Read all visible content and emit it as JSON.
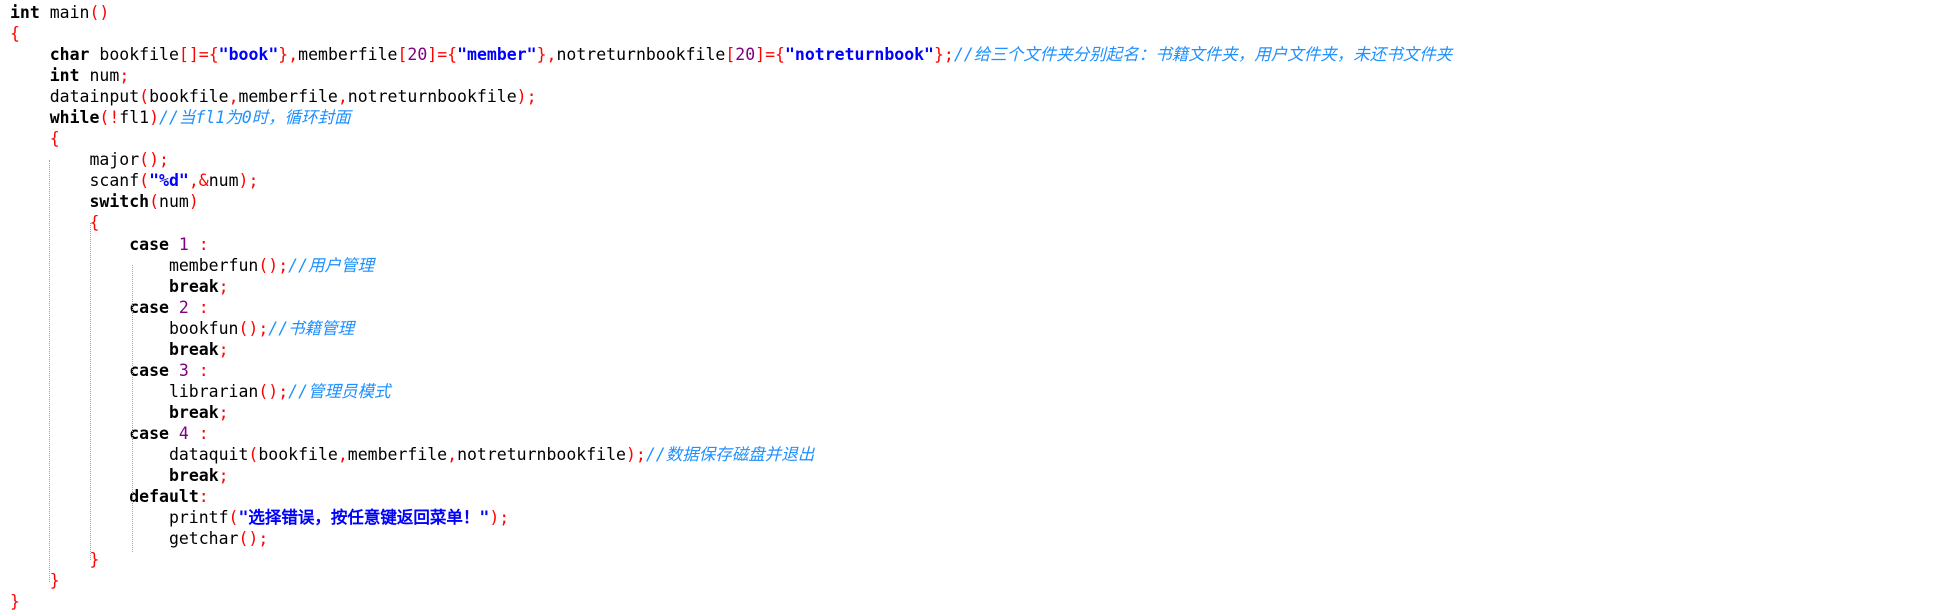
{
  "code": {
    "lines": [
      [
        {
          "t": "int",
          "c": "kw"
        },
        {
          "t": " main",
          "c": "plain"
        },
        {
          "t": "()",
          "c": "punc"
        }
      ],
      [
        {
          "t": "{",
          "c": "brace"
        }
      ],
      [
        {
          "t": "    ",
          "c": "plain"
        },
        {
          "t": "char",
          "c": "kw"
        },
        {
          "t": " bookfile",
          "c": "plain"
        },
        {
          "t": "[]={",
          "c": "punc"
        },
        {
          "t": "\"book\"",
          "c": "str"
        },
        {
          "t": "},",
          "c": "punc"
        },
        {
          "t": "memberfile",
          "c": "plain"
        },
        {
          "t": "[",
          "c": "punc"
        },
        {
          "t": "20",
          "c": "num"
        },
        {
          "t": "]={",
          "c": "punc"
        },
        {
          "t": "\"member\"",
          "c": "str"
        },
        {
          "t": "},",
          "c": "punc"
        },
        {
          "t": "notreturnbookfile",
          "c": "plain"
        },
        {
          "t": "[",
          "c": "punc"
        },
        {
          "t": "20",
          "c": "num"
        },
        {
          "t": "]={",
          "c": "punc"
        },
        {
          "t": "\"notreturnbook\"",
          "c": "str"
        },
        {
          "t": "};",
          "c": "punc"
        },
        {
          "t": "//给三个文件夹分别起名：书籍文件夹，用户文件夹，未还书文件夹",
          "c": "cm"
        }
      ],
      [
        {
          "t": "    ",
          "c": "plain"
        },
        {
          "t": "int",
          "c": "kw"
        },
        {
          "t": " num",
          "c": "plain"
        },
        {
          "t": ";",
          "c": "punc"
        }
      ],
      [
        {
          "t": "    datainput",
          "c": "plain"
        },
        {
          "t": "(",
          "c": "punc"
        },
        {
          "t": "bookfile",
          "c": "plain"
        },
        {
          "t": ",",
          "c": "punc"
        },
        {
          "t": "memberfile",
          "c": "plain"
        },
        {
          "t": ",",
          "c": "punc"
        },
        {
          "t": "notreturnbookfile",
          "c": "plain"
        },
        {
          "t": ");",
          "c": "punc"
        }
      ],
      [
        {
          "t": "    ",
          "c": "plain"
        },
        {
          "t": "while",
          "c": "kw"
        },
        {
          "t": "(!",
          "c": "punc"
        },
        {
          "t": "fl1",
          "c": "plain"
        },
        {
          "t": ")",
          "c": "punc"
        },
        {
          "t": "//当fl1为0时，循环封面",
          "c": "cm"
        }
      ],
      [
        {
          "t": "    ",
          "c": "plain"
        },
        {
          "t": "{",
          "c": "brace"
        }
      ],
      [
        {
          "t": "        major",
          "c": "plain"
        },
        {
          "t": "();",
          "c": "punc"
        }
      ],
      [
        {
          "t": "        scanf",
          "c": "plain"
        },
        {
          "t": "(",
          "c": "punc"
        },
        {
          "t": "\"%d\"",
          "c": "str"
        },
        {
          "t": ",&",
          "c": "punc"
        },
        {
          "t": "num",
          "c": "plain"
        },
        {
          "t": ");",
          "c": "punc"
        }
      ],
      [
        {
          "t": "        ",
          "c": "plain"
        },
        {
          "t": "switch",
          "c": "kw"
        },
        {
          "t": "(",
          "c": "punc"
        },
        {
          "t": "num",
          "c": "plain"
        },
        {
          "t": ")",
          "c": "punc"
        }
      ],
      [
        {
          "t": "        ",
          "c": "plain"
        },
        {
          "t": "{",
          "c": "brace"
        }
      ],
      [
        {
          "t": "            ",
          "c": "plain"
        },
        {
          "t": "case",
          "c": "kw"
        },
        {
          "t": " ",
          "c": "plain"
        },
        {
          "t": "1",
          "c": "num"
        },
        {
          "t": " :",
          "c": "punc"
        }
      ],
      [
        {
          "t": "                memberfun",
          "c": "plain"
        },
        {
          "t": "();",
          "c": "punc"
        },
        {
          "t": "//用户管理",
          "c": "cm"
        }
      ],
      [
        {
          "t": "                ",
          "c": "plain"
        },
        {
          "t": "break",
          "c": "kw"
        },
        {
          "t": ";",
          "c": "punc"
        }
      ],
      [
        {
          "t": "            ",
          "c": "plain"
        },
        {
          "t": "case",
          "c": "kw"
        },
        {
          "t": " ",
          "c": "plain"
        },
        {
          "t": "2",
          "c": "num"
        },
        {
          "t": " :",
          "c": "punc"
        }
      ],
      [
        {
          "t": "                bookfun",
          "c": "plain"
        },
        {
          "t": "();",
          "c": "punc"
        },
        {
          "t": "//书籍管理",
          "c": "cm"
        }
      ],
      [
        {
          "t": "                ",
          "c": "plain"
        },
        {
          "t": "break",
          "c": "kw"
        },
        {
          "t": ";",
          "c": "punc"
        }
      ],
      [
        {
          "t": "            ",
          "c": "plain"
        },
        {
          "t": "case",
          "c": "kw"
        },
        {
          "t": " ",
          "c": "plain"
        },
        {
          "t": "3",
          "c": "num"
        },
        {
          "t": " :",
          "c": "punc"
        }
      ],
      [
        {
          "t": "                librarian",
          "c": "plain"
        },
        {
          "t": "();",
          "c": "punc"
        },
        {
          "t": "//管理员模式",
          "c": "cm"
        }
      ],
      [
        {
          "t": "                ",
          "c": "plain"
        },
        {
          "t": "break",
          "c": "kw"
        },
        {
          "t": ";",
          "c": "punc"
        }
      ],
      [
        {
          "t": "            ",
          "c": "plain"
        },
        {
          "t": "case",
          "c": "kw"
        },
        {
          "t": " ",
          "c": "plain"
        },
        {
          "t": "4",
          "c": "num"
        },
        {
          "t": " :",
          "c": "punc"
        }
      ],
      [
        {
          "t": "                dataquit",
          "c": "plain"
        },
        {
          "t": "(",
          "c": "punc"
        },
        {
          "t": "bookfile",
          "c": "plain"
        },
        {
          "t": ",",
          "c": "punc"
        },
        {
          "t": "memberfile",
          "c": "plain"
        },
        {
          "t": ",",
          "c": "punc"
        },
        {
          "t": "notreturnbookfile",
          "c": "plain"
        },
        {
          "t": ");",
          "c": "punc"
        },
        {
          "t": "//数据保存磁盘并退出",
          "c": "cm"
        }
      ],
      [
        {
          "t": "                ",
          "c": "plain"
        },
        {
          "t": "break",
          "c": "kw"
        },
        {
          "t": ";",
          "c": "punc"
        }
      ],
      [
        {
          "t": "            ",
          "c": "plain"
        },
        {
          "t": "default",
          "c": "kw"
        },
        {
          "t": ":",
          "c": "punc"
        }
      ],
      [
        {
          "t": "                printf",
          "c": "plain"
        },
        {
          "t": "(",
          "c": "punc"
        },
        {
          "t": "\"选择错误，按任意键返回菜单！\"",
          "c": "str"
        },
        {
          "t": ");",
          "c": "punc"
        }
      ],
      [
        {
          "t": "                getchar",
          "c": "plain"
        },
        {
          "t": "();",
          "c": "punc"
        }
      ],
      [
        {
          "t": "        ",
          "c": "plain"
        },
        {
          "t": "}",
          "c": "brace"
        }
      ],
      [
        {
          "t": "    ",
          "c": "plain"
        },
        {
          "t": "}",
          "c": "brace"
        }
      ],
      [
        {
          "t": "}",
          "c": "brace"
        }
      ]
    ]
  },
  "colors": {
    "keyword": "#000000",
    "string": "#0000ff",
    "punctuation": "#ff0000",
    "number": "#800080",
    "comment": "#1e90ff"
  }
}
